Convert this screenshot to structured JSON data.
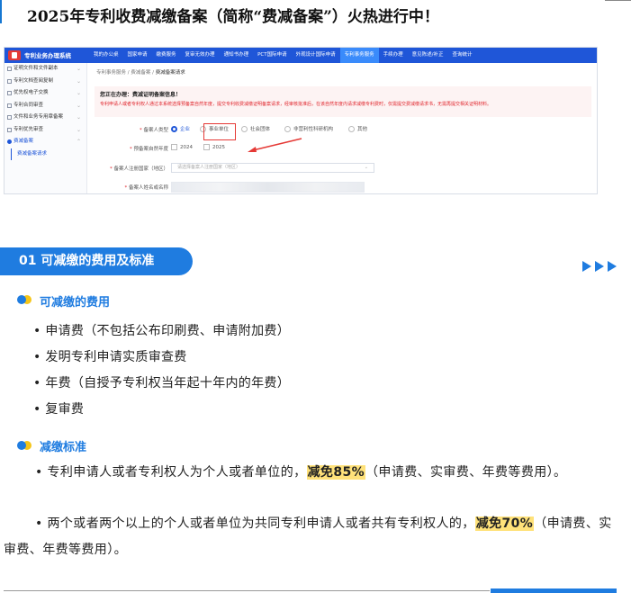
{
  "headline": "2025年专利收费减缴备案（简称“费减备案”）火热进行中！",
  "screenshot": {
    "system_name": "专利业务办理系统",
    "nav": [
      {
        "label": "我的办公桌",
        "active": false
      },
      {
        "label": "国家申请",
        "active": false
      },
      {
        "label": "缴费服务",
        "active": false
      },
      {
        "label": "复审无效办理",
        "active": false
      },
      {
        "label": "通知书办理",
        "active": false
      },
      {
        "label": "PCT国际申请",
        "active": false
      },
      {
        "label": "外观设计国际申请",
        "active": false
      },
      {
        "label": "专利事务服务",
        "active": true
      },
      {
        "label": "手续办理",
        "active": false
      },
      {
        "label": "意见陈述/补正",
        "active": false
      },
      {
        "label": "查询统计",
        "active": false
      }
    ],
    "sidebar": [
      {
        "label": "证明文件和文件副本",
        "type": "item"
      },
      {
        "label": "专利文档查阅复制",
        "type": "item"
      },
      {
        "label": "优先权电子交换",
        "type": "item"
      },
      {
        "label": "专利合同审查",
        "type": "item"
      },
      {
        "label": "文件和业务专用章备案",
        "type": "item"
      },
      {
        "label": "专利优先审查",
        "type": "item"
      },
      {
        "label": "费减备案",
        "type": "group"
      },
      {
        "label": "费减备案请求",
        "type": "sub"
      }
    ],
    "breadcrumb": [
      "专利事务服务",
      "费减备案",
      "费减备案请求"
    ],
    "notice_title": "您正在办理：费减证明备案信息！",
    "notice_text": "专利申请人或者专利权人通过本系统选择预备案自然年度，提交专利收费减缴证明备案请求，经审核批准后，在该自然年度内请求减缴专利费时，仅需提交费减缴请求书，无需再提交相关证明材料。",
    "form": {
      "type_label": "备案人类型",
      "type_options": [
        {
          "label": "企业",
          "selected": true
        },
        {
          "label": "事业单位",
          "selected": false
        },
        {
          "label": "社会团体",
          "selected": false
        },
        {
          "label": "非营利性科研机构",
          "selected": false
        },
        {
          "label": "其他",
          "selected": false
        }
      ],
      "year_label": "预备案自然年度",
      "year_options": [
        "2024",
        "2025"
      ],
      "country_label": "备案人注册国家（地区）",
      "country_placeholder": "请选择备案人注册国家（地区）",
      "name_label": "备案人姓名或名称"
    }
  },
  "section": {
    "title": "01 可减缴的费用及标准"
  },
  "fees": {
    "heading": "可减缴的费用",
    "items": [
      "申请费（不包括公布印刷费、申请附加费）",
      "发明专利申请实质审查费",
      "年费（自授予专利权当年起十年内的年费）",
      "复审费"
    ]
  },
  "standards": {
    "heading": "减缴标准",
    "p1_before": "• 专利申请人或者专利权人为个人或者单位的，",
    "p1_highlight": "减免85%",
    "p1_after": "（申请费、实审费、年费等费用）。",
    "p2_before": "• 两个或者两个以上的个人或者单位为共同专利申请人或者共有专利权人的，",
    "p2_highlight": "减免70%",
    "p2_after": "（申请费、实审费、年费等费用）。"
  },
  "colors": {
    "accent": "#1f7ce0",
    "highlight": "#ffe27a",
    "notice_red": "#e0242b"
  }
}
